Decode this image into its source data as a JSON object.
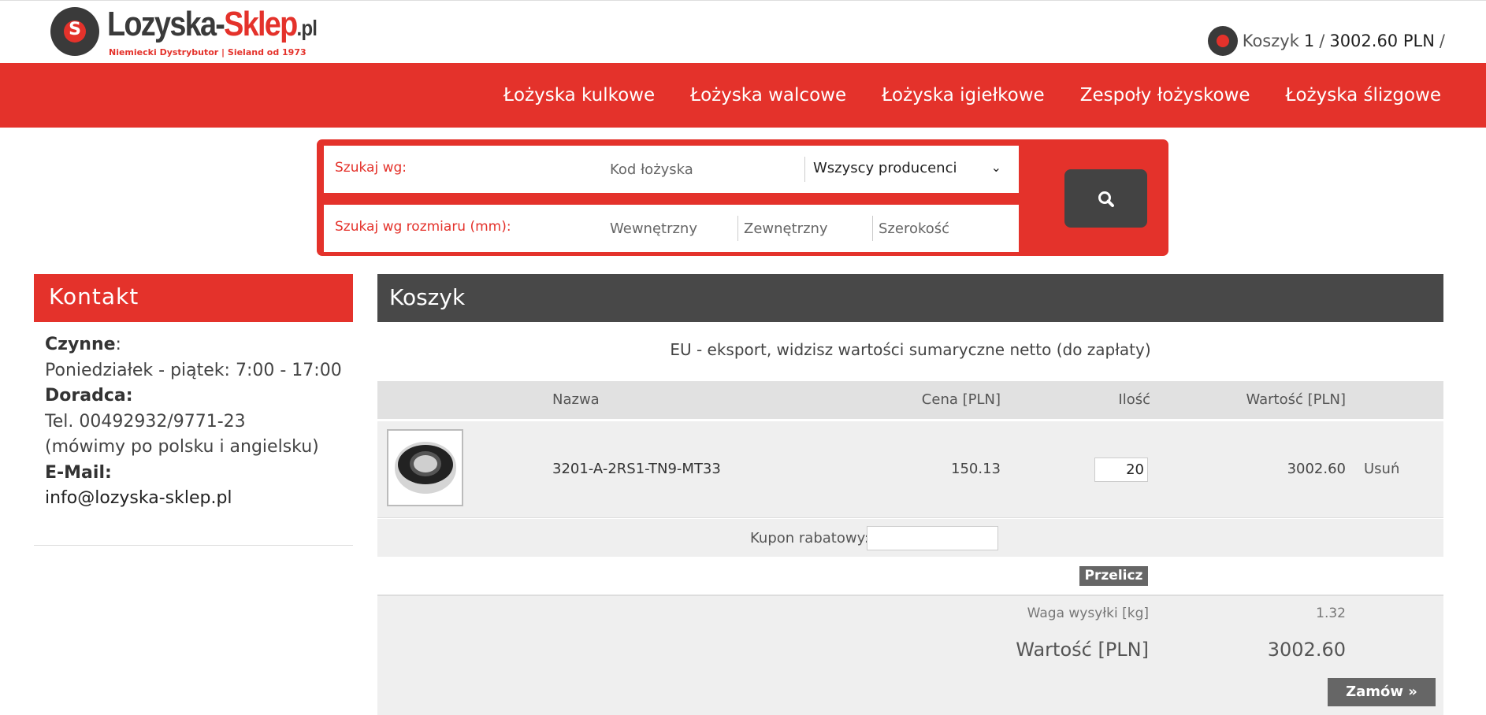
{
  "header": {
    "logo_main": "Lozyska-",
    "logo_red": "Sklep",
    "logo_pl": ".pl",
    "logo_tagline": "Niemiecki Dystrybutor | Sieland od 1973",
    "cart_label": "Koszyk",
    "cart_count": "1",
    "cart_sep": "/",
    "cart_total": "3002.60 PLN",
    "cart_end": "/"
  },
  "nav": {
    "items": [
      "Łożyska kulkowe",
      "Łożyska walcowe",
      "Łożyska igiełkowe",
      "Zespoły łożyskowe",
      "Łożyska ślizgowe"
    ]
  },
  "search": {
    "label_by": "Szukaj wg:",
    "code_placeholder": "Kod łożyska",
    "manufacturer_selected": "Wszyscy producenci",
    "label_size": "Szukaj wg rozmiaru (mm):",
    "inner_placeholder": "Wewnętrzny",
    "outer_placeholder": "Zewnętrzny",
    "width_placeholder": "Szerokość"
  },
  "sidebar": {
    "title": "Kontakt",
    "hours_label": "Czynne",
    "hours_colon": ":",
    "hours_value": "Poniedziałek - piątek: 7:00 - 17:00",
    "advisor_label": "Doradca:",
    "phone": "Tel. 00492932/9771-23",
    "languages": "(mówimy po polsku i angielsku)",
    "email_label": "E-Mail:",
    "email": "info@lozyska-sklep.pl"
  },
  "cart": {
    "title": "Koszyk",
    "note": "EU - eksport, widzisz wartości sumaryczne netto (do zapłaty)",
    "columns": {
      "name": "Nazwa",
      "price": "Cena [PLN]",
      "qty": "Ilość",
      "value": "Wartość [PLN]"
    },
    "item": {
      "name": "3201-A-2RS1-TN9-MT33",
      "price": "150.13",
      "qty": "20",
      "value": "3002.60",
      "remove": "Usuń"
    },
    "coupon_label": "Kupon rabatowy:",
    "recalc_label": "Przelicz",
    "weight_label": "Waga wysyłki [kg]",
    "weight_value": "1.32",
    "total_label": "Wartość [PLN]",
    "total_value": "3002.60",
    "order_label": "Zamów »"
  }
}
